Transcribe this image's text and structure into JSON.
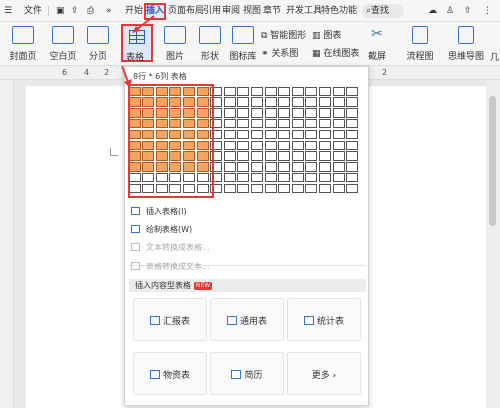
{
  "menu": {
    "file": "文件",
    "tabs": [
      "开始",
      "插入",
      "页面布局",
      "引用",
      "审阅",
      "视图",
      "章节",
      "开发工具",
      "特色功能"
    ],
    "active_tab": "插入",
    "search": "查找"
  },
  "ribbon": {
    "cover": "封面页",
    "blank": "空白页",
    "pagebreak": "分页",
    "table": "表格",
    "picture": "图片",
    "shape": "形状",
    "iconlib": "图标库",
    "smartart": "智能图形",
    "relation": "关系图",
    "chart": "图表",
    "online_chart": "在线图表",
    "screenshot": "截屏",
    "flowchart": "流程图",
    "mindmap": "思维导图",
    "more": "几"
  },
  "ruler_ticks": [
    "6",
    "4",
    "2",
    "",
    "2"
  ],
  "table_dropdown": {
    "header": "8行 * 6列 表格",
    "rows": 10,
    "cols": 17,
    "selected_rows": 8,
    "selected_cols": 6,
    "items": [
      {
        "label": "插入表格(I)",
        "enabled": true
      },
      {
        "label": "绘制表格(W)",
        "enabled": true
      },
      {
        "label": "文本转换成表格...",
        "enabled": false
      },
      {
        "label": "表格转换成文本...",
        "enabled": false
      }
    ],
    "section_title": "插入内容型表格",
    "badge": "NEW",
    "cards": [
      {
        "label": "汇报表"
      },
      {
        "label": "通用表"
      },
      {
        "label": "统计表"
      },
      {
        "label": "物资表"
      },
      {
        "label": "简历"
      },
      {
        "label": "更多 ›"
      }
    ]
  },
  "colors": {
    "selected_cell": "#f4a460",
    "highlight": "#e53935",
    "accent": "#2d5cc0"
  }
}
